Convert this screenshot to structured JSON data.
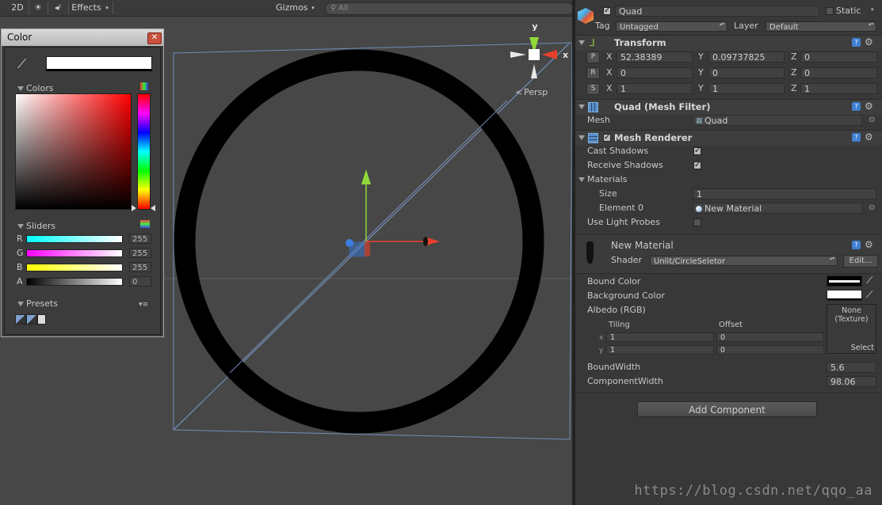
{
  "toolbar": {
    "btn_2d": "2D",
    "effects": "Effects",
    "gizmos": "Gizmos",
    "search_placeholder": "All"
  },
  "scene": {
    "persp_label": "Persp",
    "axis_y": "y",
    "axis_x": "x"
  },
  "color_window": {
    "title": "Color",
    "colors_label": "Colors",
    "sliders_label": "Sliders",
    "presets_label": "Presets",
    "r_label": "R",
    "r_value": "255",
    "g_label": "G",
    "g_value": "255",
    "b_label": "B",
    "b_value": "255",
    "a_label": "A",
    "a_value": "0"
  },
  "inspector": {
    "object_name": "Quad",
    "static_label": "Static",
    "tag_label": "Tag",
    "tag_value": "Untagged",
    "layer_label": "Layer",
    "layer_value": "Default",
    "transform": {
      "title": "Transform",
      "pos": {
        "btn": "P",
        "x": "52.38389",
        "y": "0.09737825",
        "z": "0"
      },
      "rot": {
        "btn": "R",
        "x": "0",
        "y": "0",
        "z": "0"
      },
      "scale": {
        "btn": "S",
        "x": "1",
        "y": "1",
        "z": "1"
      },
      "x_label": "X",
      "y_label": "Y",
      "z_label": "Z"
    },
    "mesh_filter": {
      "title": "Quad (Mesh Filter)",
      "mesh_label": "Mesh",
      "mesh_value": "Quad"
    },
    "mesh_renderer": {
      "title": "Mesh Renderer",
      "cast_shadows": "Cast Shadows",
      "receive_shadows": "Receive Shadows",
      "materials": "Materials",
      "size_label": "Size",
      "size_value": "1",
      "element0_label": "Element 0",
      "element0_value": "New Material",
      "light_probes": "Use Light Probes"
    },
    "material": {
      "name": "New Material",
      "shader_label": "Shader",
      "shader_value": "Unlit/CircleSeletor",
      "edit_button": "Edit...",
      "bound_color": "Bound Color",
      "background_color": "Background Color",
      "albedo": "Albedo (RGB)",
      "tiling": "Tiling",
      "offset": "Offset",
      "tile_x_label": "x",
      "tile_x": "1",
      "offset_x": "0",
      "tile_y_label": "y",
      "tile_y": "1",
      "offset_y": "0",
      "texture_none": "None",
      "texture_type": "(Texture)",
      "select": "Select",
      "bound_width_label": "BoundWidth",
      "bound_width_value": "5.6",
      "component_width_label": "ComponentWidth",
      "component_width_value": "98.06"
    },
    "add_component": "Add Component"
  },
  "watermark": "https://blog.csdn.net/qqo_aa",
  "colors": {
    "accent_x": "#e8412b",
    "accent_y": "#8fd93a",
    "accent_z": "#3b7ee0"
  }
}
